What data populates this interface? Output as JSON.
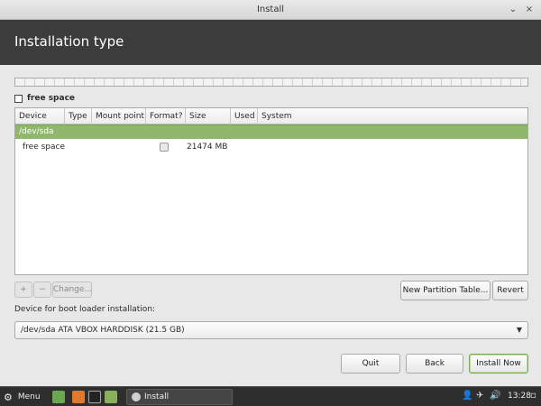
{
  "window": {
    "title": "Install",
    "minimize_glyph": "⌄",
    "close_glyph": "×"
  },
  "header": {
    "title": "Installation type"
  },
  "partition_bar": {
    "legend_label": "free space"
  },
  "table": {
    "columns": [
      "Device",
      "Type",
      "Mount point",
      "Format?",
      "Size",
      "Used",
      "System"
    ],
    "device_row": {
      "device": "/dev/sda"
    },
    "rows": [
      {
        "device": "free space",
        "type": "",
        "mount_point": "",
        "format": false,
        "size": "21474 MB",
        "used": "",
        "system": ""
      }
    ]
  },
  "table_actions": {
    "add": "+",
    "remove": "−",
    "change": "Change...",
    "new_table": "New Partition Table...",
    "revert": "Revert"
  },
  "bootloader": {
    "label": "Device for boot loader installation:",
    "selected": "/dev/sda   ATA VBOX HARDDISK (21.5 GB)"
  },
  "footer": {
    "quit": "Quit",
    "back": "Back",
    "install_now": "Install Now"
  },
  "taskbar": {
    "menu_label": "Menu",
    "task_label": "Install",
    "clock": "13:28",
    "icons": [
      "show-desktop-icon",
      "firefox-icon",
      "terminal-icon",
      "files-icon"
    ]
  },
  "colors": {
    "header_bg": "#3c3c3c",
    "device_row": "#8fb86a",
    "taskbar_bg": "#2e2e2e"
  }
}
